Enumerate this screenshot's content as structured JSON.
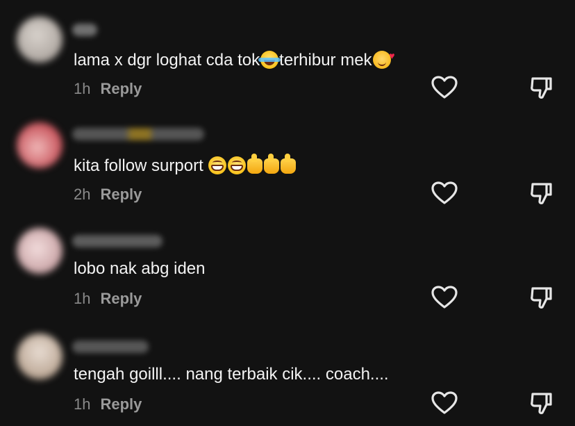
{
  "comments": [
    {
      "text_parts": [
        "lama x dgr loghat cda tok",
        "terhibur mek"
      ],
      "time": "1h",
      "reply_label": "Reply"
    },
    {
      "text": "kita follow surport ",
      "time": "2h",
      "reply_label": "Reply"
    },
    {
      "text": "lobo nak abg iden",
      "time": "1h",
      "reply_label": "Reply"
    },
    {
      "text": "tengah goilll.... nang terbaik cik.... coach....",
      "time": "1h",
      "reply_label": "Reply"
    }
  ],
  "icons": {
    "like": "heart-outline-icon",
    "dislike": "thumbs-down-outline-icon"
  },
  "colors": {
    "background": "#121212",
    "text": "#f3f3f3",
    "meta": "#8a8a8a"
  }
}
